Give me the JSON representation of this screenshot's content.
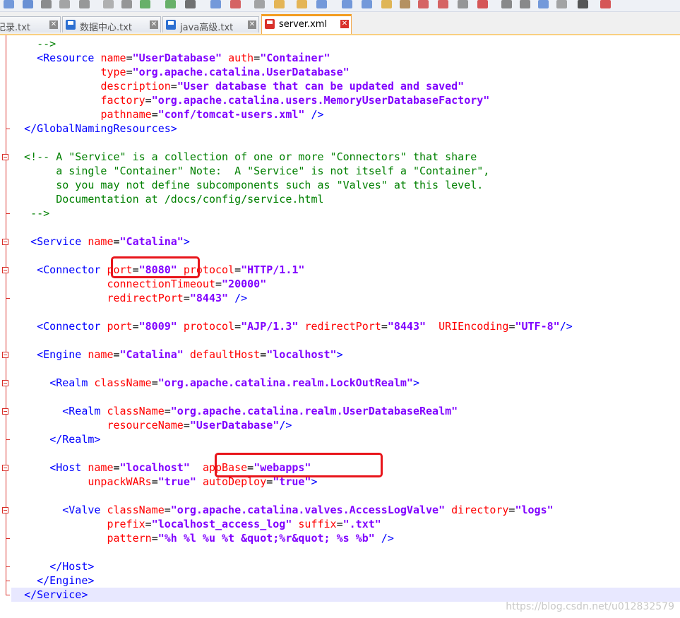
{
  "tabs": [
    {
      "label": "记录.txt",
      "active": false
    },
    {
      "label": "数据中心.txt",
      "active": false
    },
    {
      "label": "java高级.txt",
      "active": false
    },
    {
      "label": "server.xml",
      "active": true
    }
  ],
  "code_lines": [
    {
      "text": "    -->",
      "current": false
    },
    {
      "text": "    <Resource name=\"UserDatabase\" auth=\"Container\"",
      "current": false
    },
    {
      "text": "              type=\"org.apache.catalina.UserDatabase\"",
      "current": false
    },
    {
      "text": "              description=\"User database that can be updated and saved\"",
      "current": false
    },
    {
      "text": "              factory=\"org.apache.catalina.users.MemoryUserDatabaseFactory\"",
      "current": false
    },
    {
      "text": "              pathname=\"conf/tomcat-users.xml\" />",
      "current": false
    },
    {
      "text": "  </GlobalNamingResources>",
      "current": false
    },
    {
      "text": "",
      "current": false
    },
    {
      "text": "  <!-- A \"Service\" is a collection of one or more \"Connectors\" that share",
      "current": false
    },
    {
      "text": "       a single \"Container\" Note:  A \"Service\" is not itself a \"Container\",",
      "current": false
    },
    {
      "text": "       so you may not define subcomponents such as \"Valves\" at this level.",
      "current": false
    },
    {
      "text": "       Documentation at /docs/config/service.html",
      "current": false
    },
    {
      "text": "   -->",
      "current": false
    },
    {
      "text": "",
      "current": false
    },
    {
      "text": "   <Service name=\"Catalina\">",
      "current": false
    },
    {
      "text": "",
      "current": false
    },
    {
      "text": "    <Connector port=\"8080\" protocol=\"HTTP/1.1\"",
      "current": false
    },
    {
      "text": "               connectionTimeout=\"20000\"",
      "current": false
    },
    {
      "text": "               redirectPort=\"8443\" />",
      "current": false
    },
    {
      "text": "",
      "current": false
    },
    {
      "text": "    <Connector port=\"8009\" protocol=\"AJP/1.3\" redirectPort=\"8443\"  URIEncoding=\"UTF-8\"/>",
      "current": false
    },
    {
      "text": "",
      "current": false
    },
    {
      "text": "    <Engine name=\"Catalina\" defaultHost=\"localhost\">",
      "current": false
    },
    {
      "text": "",
      "current": false
    },
    {
      "text": "      <Realm className=\"org.apache.catalina.realm.LockOutRealm\">",
      "current": false
    },
    {
      "text": "",
      "current": false
    },
    {
      "text": "        <Realm className=\"org.apache.catalina.realm.UserDatabaseRealm\"",
      "current": false
    },
    {
      "text": "               resourceName=\"UserDatabase\"/>",
      "current": false
    },
    {
      "text": "      </Realm>",
      "current": false
    },
    {
      "text": "",
      "current": false
    },
    {
      "text": "      <Host name=\"localhost\"  appBase=\"webapps\"",
      "current": false
    },
    {
      "text": "            unpackWARs=\"true\" autoDeploy=\"true\">",
      "current": false
    },
    {
      "text": "",
      "current": false
    },
    {
      "text": "        <Valve className=\"org.apache.catalina.valves.AccessLogValve\" directory=\"logs\"",
      "current": false
    },
    {
      "text": "               prefix=\"localhost_access_log\" suffix=\".txt\"",
      "current": false
    },
    {
      "text": "               pattern=\"%h %l %u %t &quot;%r&quot; %s %b\" />",
      "current": false
    },
    {
      "text": "",
      "current": false
    },
    {
      "text": "      </Host>",
      "current": false
    },
    {
      "text": "    </Engine>",
      "current": false
    },
    {
      "text": "  </Service>",
      "current": true
    }
  ],
  "annotations": {
    "color": "#e8151b"
  },
  "watermark": "https://blog.csdn.net/u012832579"
}
